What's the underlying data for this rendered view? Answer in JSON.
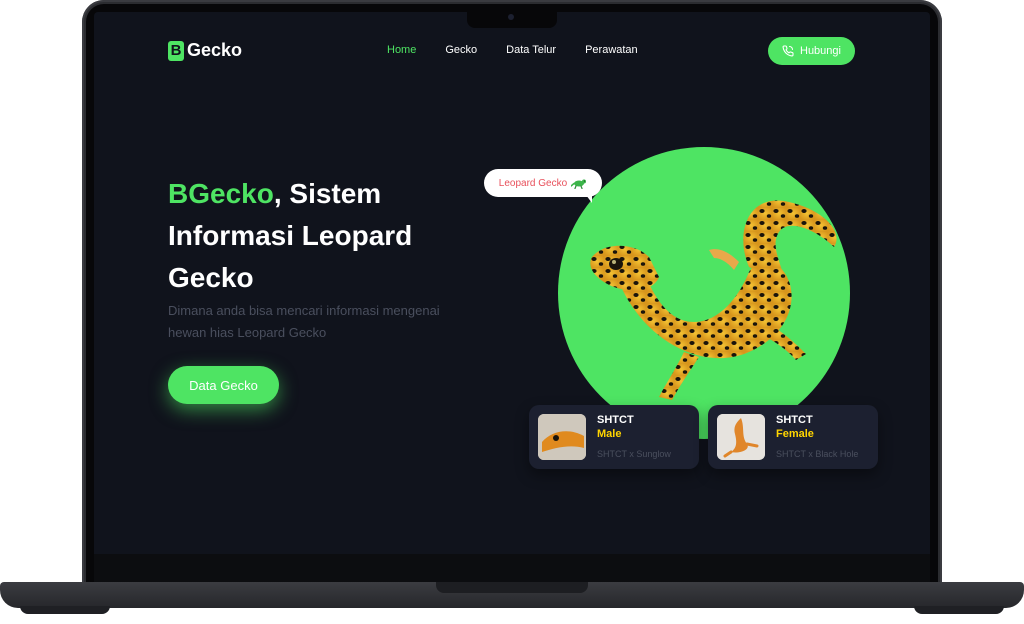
{
  "app": {
    "logo_mark": "B",
    "logo_text": "Gecko"
  },
  "nav": {
    "items": [
      "Home",
      "Gecko",
      "Data Telur",
      "Perawatan"
    ],
    "active_index": 0,
    "contact_label": "Hubungi"
  },
  "hero": {
    "title_brand": "BGecko",
    "title_rest": ", Sistem Informasi Leopard Gecko",
    "subtitle": "Dimana anda bisa mencari informasi mengenai hewan hias Leopard Gecko",
    "cta_label": "Data Gecko"
  },
  "bubble": {
    "label": "Leopard Gecko"
  },
  "cards": [
    {
      "code": "SHTCT",
      "sex": "Male",
      "morph": "SHTCT x Sunglow"
    },
    {
      "code": "SHTCT",
      "sex": "Female",
      "morph": "SHTCT x Black Hole"
    }
  ],
  "colors": {
    "accent": "#4ee463",
    "background": "#10131c",
    "card": "#1c2030",
    "sex_highlight": "#ffd500",
    "bubble_text": "#e8505b"
  },
  "icons": {
    "contact": "phone-icon",
    "bubble": "lizard-icon"
  }
}
